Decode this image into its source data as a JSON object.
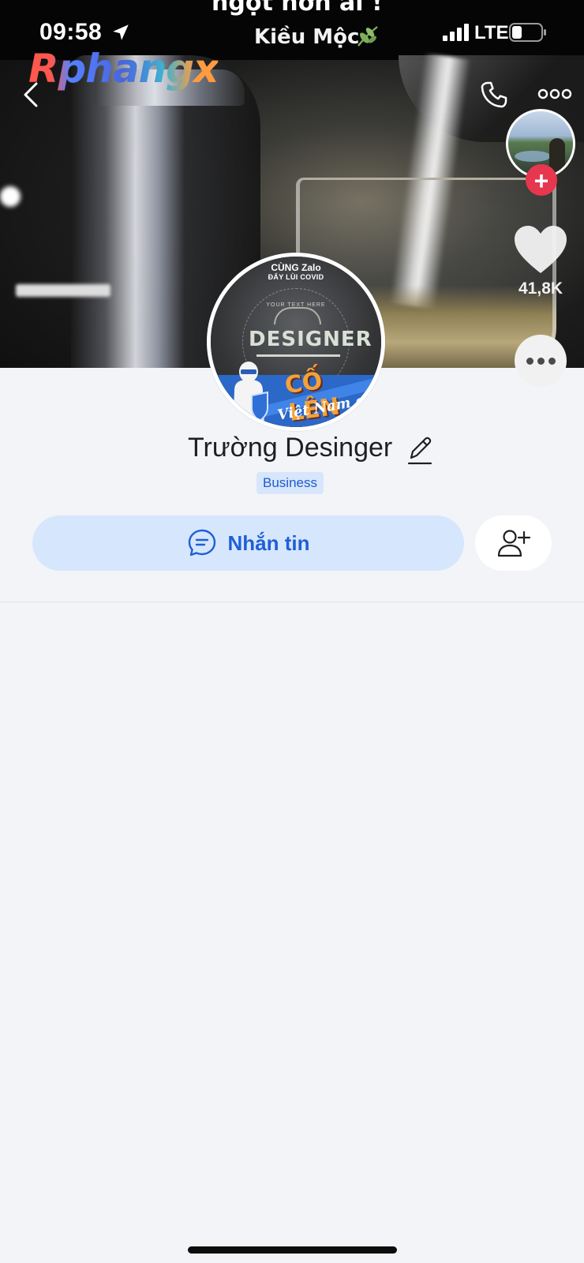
{
  "status_bar": {
    "time": "09:58",
    "song_line_top": "ngọt hơn ai !",
    "song_line": "Kiều Mộc",
    "network": "LTE"
  },
  "watermark": "Rphangx",
  "story_rail": {
    "like_count": "41,8K"
  },
  "avatar": {
    "line1": "CÙNG Zalo",
    "line2": "ĐẨY LÙI COVID",
    "curve_text": "YOUR TEXT HERE",
    "title": "DESIGNER",
    "slogan": "CỐ LÊN",
    "slogan2": "Việt Nam ơi!"
  },
  "profile": {
    "name": "Trường Desinger",
    "badge": "Business"
  },
  "actions": {
    "message_label": "Nhắn tin"
  },
  "colors": {
    "accent": "#1f5fd6",
    "button_bg": "#d6e6fd",
    "badge_bg": "#d8e6fb",
    "plus_red": "#e6374e",
    "page_bg": "#f3f4f7"
  },
  "icons": {
    "back": "chevron-left-icon",
    "call": "phone-icon",
    "more": "more-horizontal-icon",
    "edit": "pencil-icon",
    "message": "chat-bubble-icon",
    "add_friend": "user-plus-icon",
    "like": "heart-icon"
  }
}
